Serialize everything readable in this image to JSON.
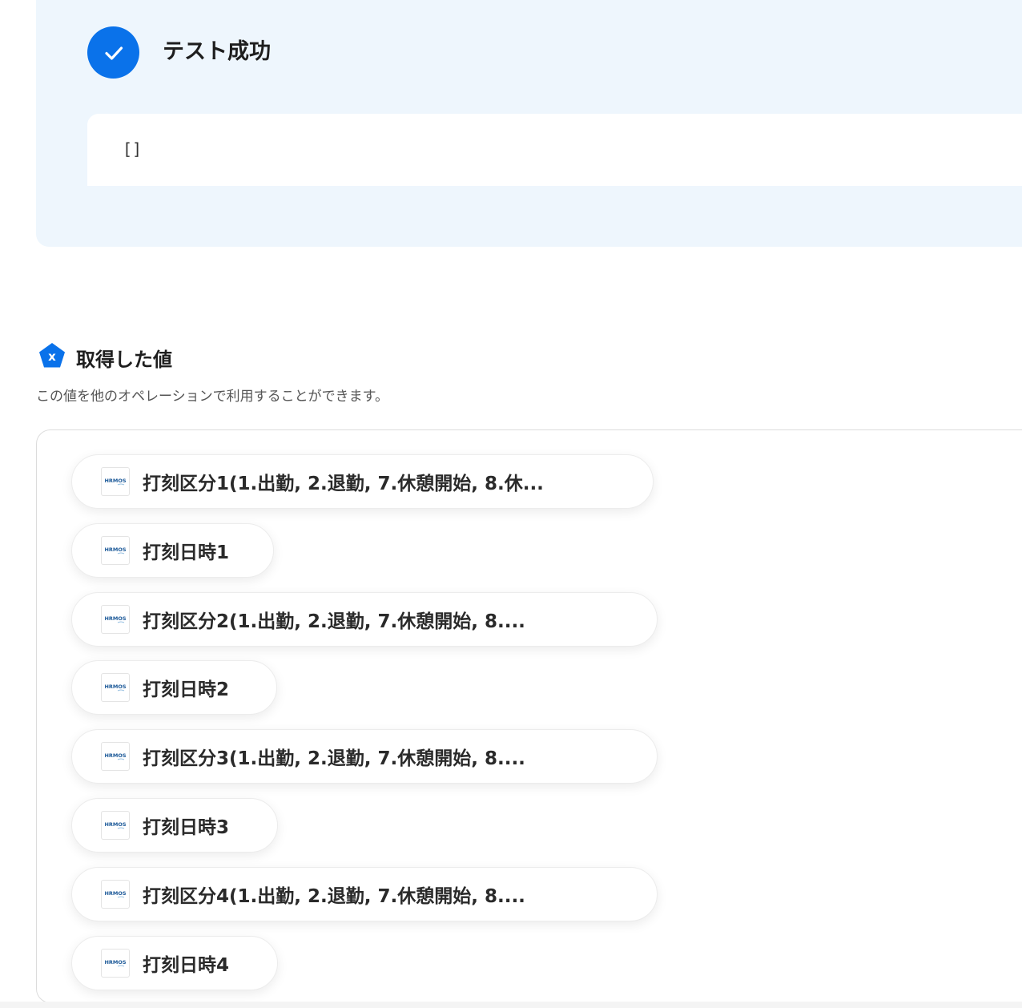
{
  "test_result": {
    "title": "テスト成功",
    "output": "[]",
    "status_color": "#0a72ea"
  },
  "values_section": {
    "title": "取得した値",
    "description": "この値を他のオペレーションで利用することができます。",
    "items": [
      {
        "label": "打刻区分1(1.出勤, 2.退勤, 7.休憩開始, 8.休...",
        "icon": "hrmos-logo-icon"
      },
      {
        "label": "打刻日時1",
        "icon": "hrmos-logo-icon"
      },
      {
        "label": "打刻区分2(1.出勤, 2.退勤, 7.休憩開始, 8....",
        "icon": "hrmos-logo-icon"
      },
      {
        "label": "打刻日時2",
        "icon": "hrmos-logo-icon"
      },
      {
        "label": "打刻区分3(1.出勤, 2.退勤, 7.休憩開始, 8....",
        "icon": "hrmos-logo-icon"
      },
      {
        "label": "打刻日時3",
        "icon": "hrmos-logo-icon"
      },
      {
        "label": "打刻区分4(1.出勤, 2.退勤, 7.休憩開始, 8....",
        "icon": "hrmos-logo-icon"
      },
      {
        "label": "打刻日時4",
        "icon": "hrmos-logo-icon"
      }
    ]
  },
  "colors": {
    "accent": "#0a72ea",
    "panel_bg": "#eef6fd"
  }
}
